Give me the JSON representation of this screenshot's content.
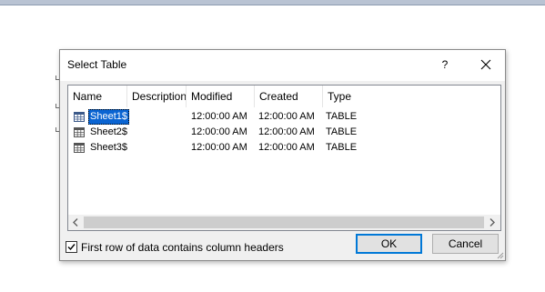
{
  "dialog": {
    "title": "Select Table",
    "help_label": "?",
    "close_icon": "close-icon"
  },
  "listview": {
    "columns": [
      "Name",
      "Description",
      "Modified",
      "Created",
      "Type"
    ],
    "rows": [
      {
        "name": "Sheet1$",
        "description": "",
        "modified": "12:00:00 AM",
        "created": "12:00:00 AM",
        "type": "TABLE",
        "selected": true
      },
      {
        "name": "Sheet2$",
        "description": "",
        "modified": "12:00:00 AM",
        "created": "12:00:00 AM",
        "type": "TABLE",
        "selected": false
      },
      {
        "name": "Sheet3$",
        "description": "",
        "modified": "12:00:00 AM",
        "created": "12:00:00 AM",
        "type": "TABLE",
        "selected": false
      }
    ],
    "row_icon": "table-icon"
  },
  "options": {
    "header_checkbox_label": "First row of data contains column headers",
    "header_checkbox_checked": true
  },
  "buttons": {
    "ok_label": "OK",
    "cancel_label": "Cancel"
  },
  "colors": {
    "selection": "#0a64d2",
    "default_button_border": "#0078d7"
  }
}
